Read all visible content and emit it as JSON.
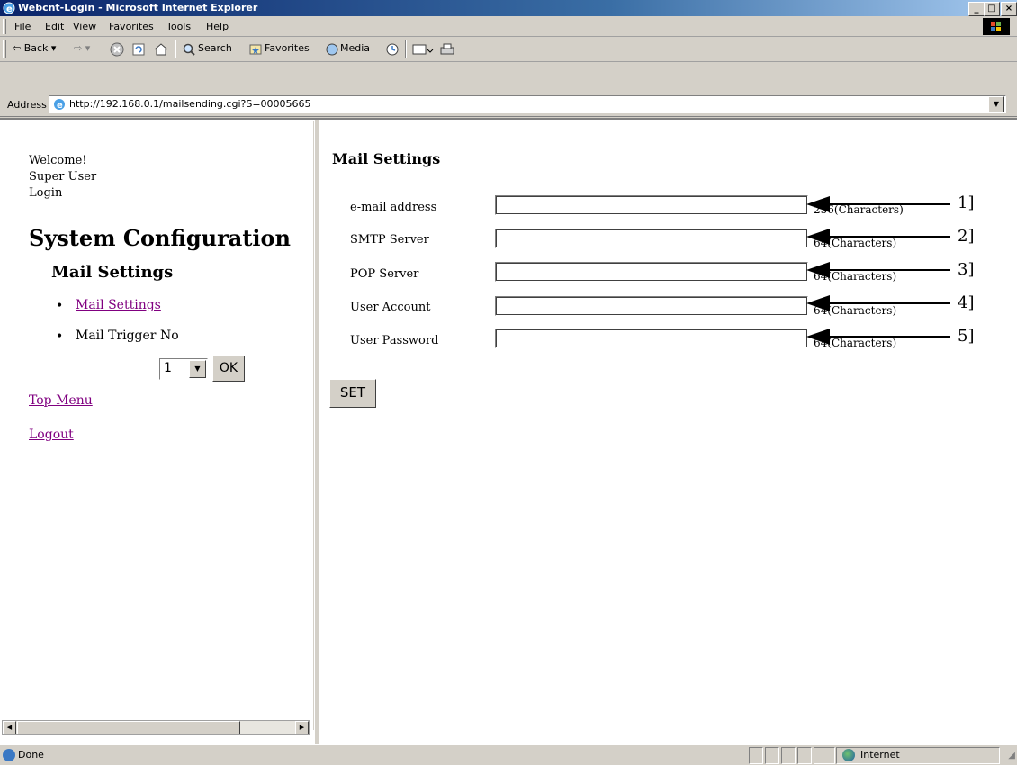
{
  "window": {
    "title": "Webcnt-Login - Microsoft Internet Explorer"
  },
  "menu": [
    "File",
    "Edit",
    "View",
    "Favorites",
    "Tools",
    "Help"
  ],
  "toolbar": {
    "back": "⇦ Back ▾",
    "forward": "⇨ ▾",
    "search": "Search",
    "favorites": "Favorites",
    "media": "Media"
  },
  "address": {
    "label": "Address",
    "url": "http://192.168.0.1/mailsending.cgi?S=00005665"
  },
  "left": {
    "welcome": "Welcome!",
    "user": "Super User",
    "login": "Login",
    "heading": "System Configuration",
    "subheading": "Mail Settings",
    "item1": "Mail Settings",
    "item2": "Mail Trigger No",
    "trigger_value": "1",
    "ok": "OK",
    "top_menu": "Top Menu",
    "logout": "Logout"
  },
  "main": {
    "title": "Mail Settings",
    "fields": [
      {
        "label": "e-mail address",
        "hint": "256(Characters)",
        "num": "1]"
      },
      {
        "label": "SMTP Server",
        "hint": "64(Characters)",
        "num": "2]"
      },
      {
        "label": "POP Server",
        "hint": "64(Characters)",
        "num": "3]"
      },
      {
        "label": "User Account",
        "hint": "64(Characters)",
        "num": "4]"
      },
      {
        "label": "User Password",
        "hint": "64(Characters)",
        "num": "5]"
      }
    ],
    "set": "SET"
  },
  "status": {
    "left": "Done",
    "zone": "Internet"
  }
}
